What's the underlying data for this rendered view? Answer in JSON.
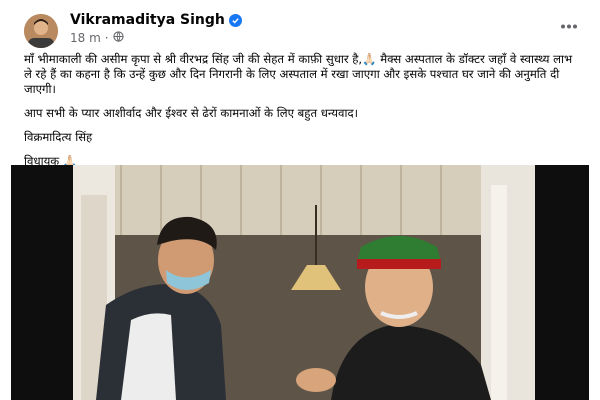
{
  "post": {
    "author": "Vikramaditya Singh",
    "verified": true,
    "time": "18 m",
    "privacy_icon": "globe-icon",
    "more_icon": "more-dots-icon",
    "paragraphs": [
      "माँ भीमाकाली की असीम कृपा से श्री वीरभद्र सिंह जी की सेहत में काफ़ी सुधार है,🙏🏻 मैक्स अस्पताल के डॉक्टर जहाँ वे स्वास्थ्य लाभ ले रहे हैं का कहना है कि उन्हें कुछ और दिन निगरानी के लिए अस्पताल में रखा जाएगा और इसके पश्चात घर जाने की अनुमति दी जाएगी।",
      "आप सभी के प्यार आशीर्वाद और ईश्वर से ढेरों कामनाओं के लिए बहुत धन्यवाद।"
    ],
    "signature_name": "विक्रमादित्य सिंह",
    "signature_title": "विधायक 🙏🏻",
    "colors": {
      "verified": "#1877f2",
      "secondary_text": "#65676b",
      "cap_green": "#2e7d32",
      "cap_band": "#b71c1c"
    }
  }
}
